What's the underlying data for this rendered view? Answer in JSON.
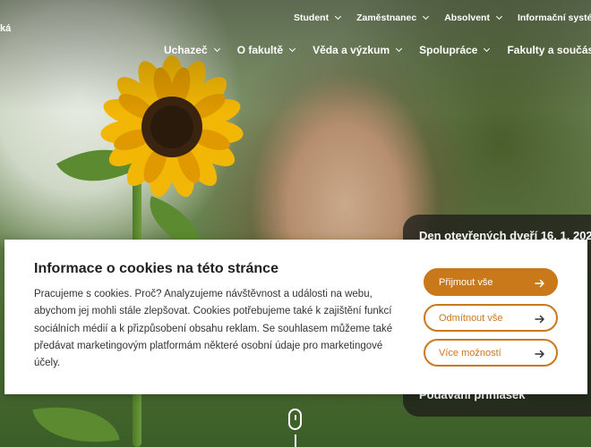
{
  "header": {
    "brand_fragment": "ká",
    "top_nav": [
      {
        "label": "Student"
      },
      {
        "label": "Zaměstnanec"
      },
      {
        "label": "Absolvent"
      },
      {
        "label": "Informační systémy"
      }
    ],
    "main_nav": [
      {
        "label": "Uchazeč"
      },
      {
        "label": "O fakultě"
      },
      {
        "label": "Věda a výzkum"
      },
      {
        "label": "Spolupráce"
      },
      {
        "label": "Fakulty a součásti"
      }
    ]
  },
  "side_panel": {
    "event_title": "Den otevřených dveří 16. 1. 202",
    "applications_label": "Podávání přihlášek"
  },
  "cookie_banner": {
    "title": "Informace o cookies na této stránce",
    "body": "Pracujeme s cookies. Proč? Analyzujeme návštěvnost a události na webu, abychom jej mohli stále zlepšovat. Cookies potřebujeme také k zajištění funkcí sociálních médií a k přizpůsobení obsahu reklam. Se souhlasem můžeme také předávat marketingovým platformám některé osobní údaje pro marketingové účely.",
    "accept_all": "Přijmout vše",
    "reject_all": "Odmítnout vše",
    "more_options": "Více možností"
  },
  "colors": {
    "accent": "#c9781a",
    "panel_bg": "#1e1e19"
  }
}
